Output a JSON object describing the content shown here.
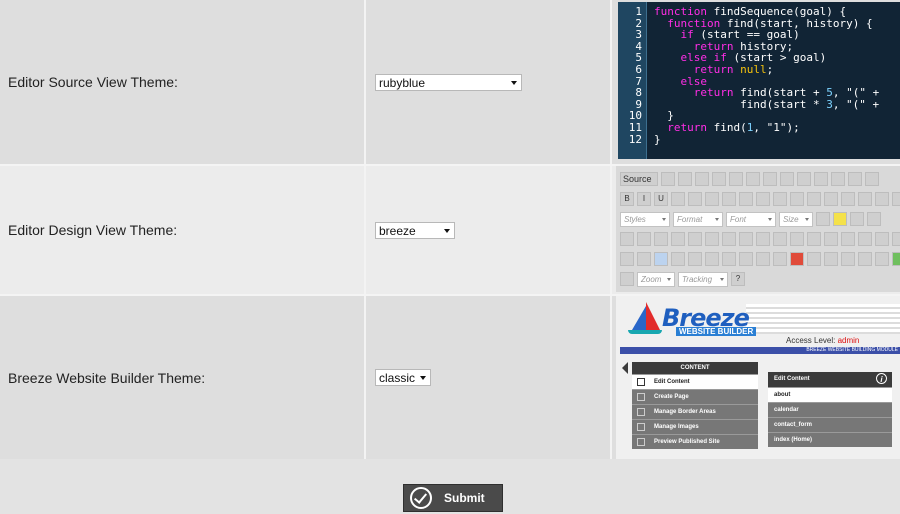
{
  "settings": [
    {
      "label": "Editor Source View Theme:",
      "value": "rubyblue"
    },
    {
      "label": "Editor Design View Theme:",
      "value": "breeze"
    },
    {
      "label": "Breeze Website Builder Theme:",
      "value": "classic"
    }
  ],
  "code_preview": {
    "lines": [
      {
        "n": "1",
        "html": "<span class='kw'>function</span> <span class='fn'>findSequence</span>(goal) {"
      },
      {
        "n": "2",
        "html": "  <span class='kw'>function</span> <span class='fn'>find</span>(start, history) {"
      },
      {
        "n": "3",
        "html": "    <span class='kw'>if</span> (start == goal)"
      },
      {
        "n": "4",
        "html": "      <span class='kw'>return</span> history;"
      },
      {
        "n": "5",
        "html": "    <span class='kw'>else if</span> (start &gt; goal)"
      },
      {
        "n": "6",
        "html": "      <span class='kw'>return</span> <span class='atom'>null</span>;"
      },
      {
        "n": "7",
        "html": "    <span class='kw'>else</span>"
      },
      {
        "n": "8",
        "html": "      <span class='kw'>return</span> find(start + <span class='num'>5</span>, \"(\" +"
      },
      {
        "n": "9",
        "html": "             find(start * <span class='num'>3</span>, \"(\" +"
      },
      {
        "n": "10",
        "html": "  }"
      },
      {
        "n": "11",
        "html": "  <span class='kw'>return</span> find(<span class='num'>1</span>, \"1\");"
      },
      {
        "n": "12",
        "html": "}"
      }
    ]
  },
  "toolbar_preview": {
    "source_label": "Source",
    "styles": "Styles",
    "format": "Format",
    "font": "Font",
    "size": "Size",
    "zoom": "Zoom",
    "tracking": "Tracking"
  },
  "breeze_preview": {
    "logo": "Breeze",
    "logo_sub": "WEBSITE BUILDER",
    "access_label": "Access Level:",
    "access_value": "admin",
    "module_bar": "BREEZE WEBSITE BUILDING MODULE",
    "menu_header": "CONTENT",
    "menu_items": [
      "Edit Content",
      "Create Page",
      "Manage Border Areas",
      "Manage Images",
      "Preview Published Site"
    ],
    "panel_header": "Edit Content",
    "panel_items": [
      "about",
      "calendar",
      "contact_form",
      "index (Home)"
    ]
  },
  "submit_label": "Submit"
}
